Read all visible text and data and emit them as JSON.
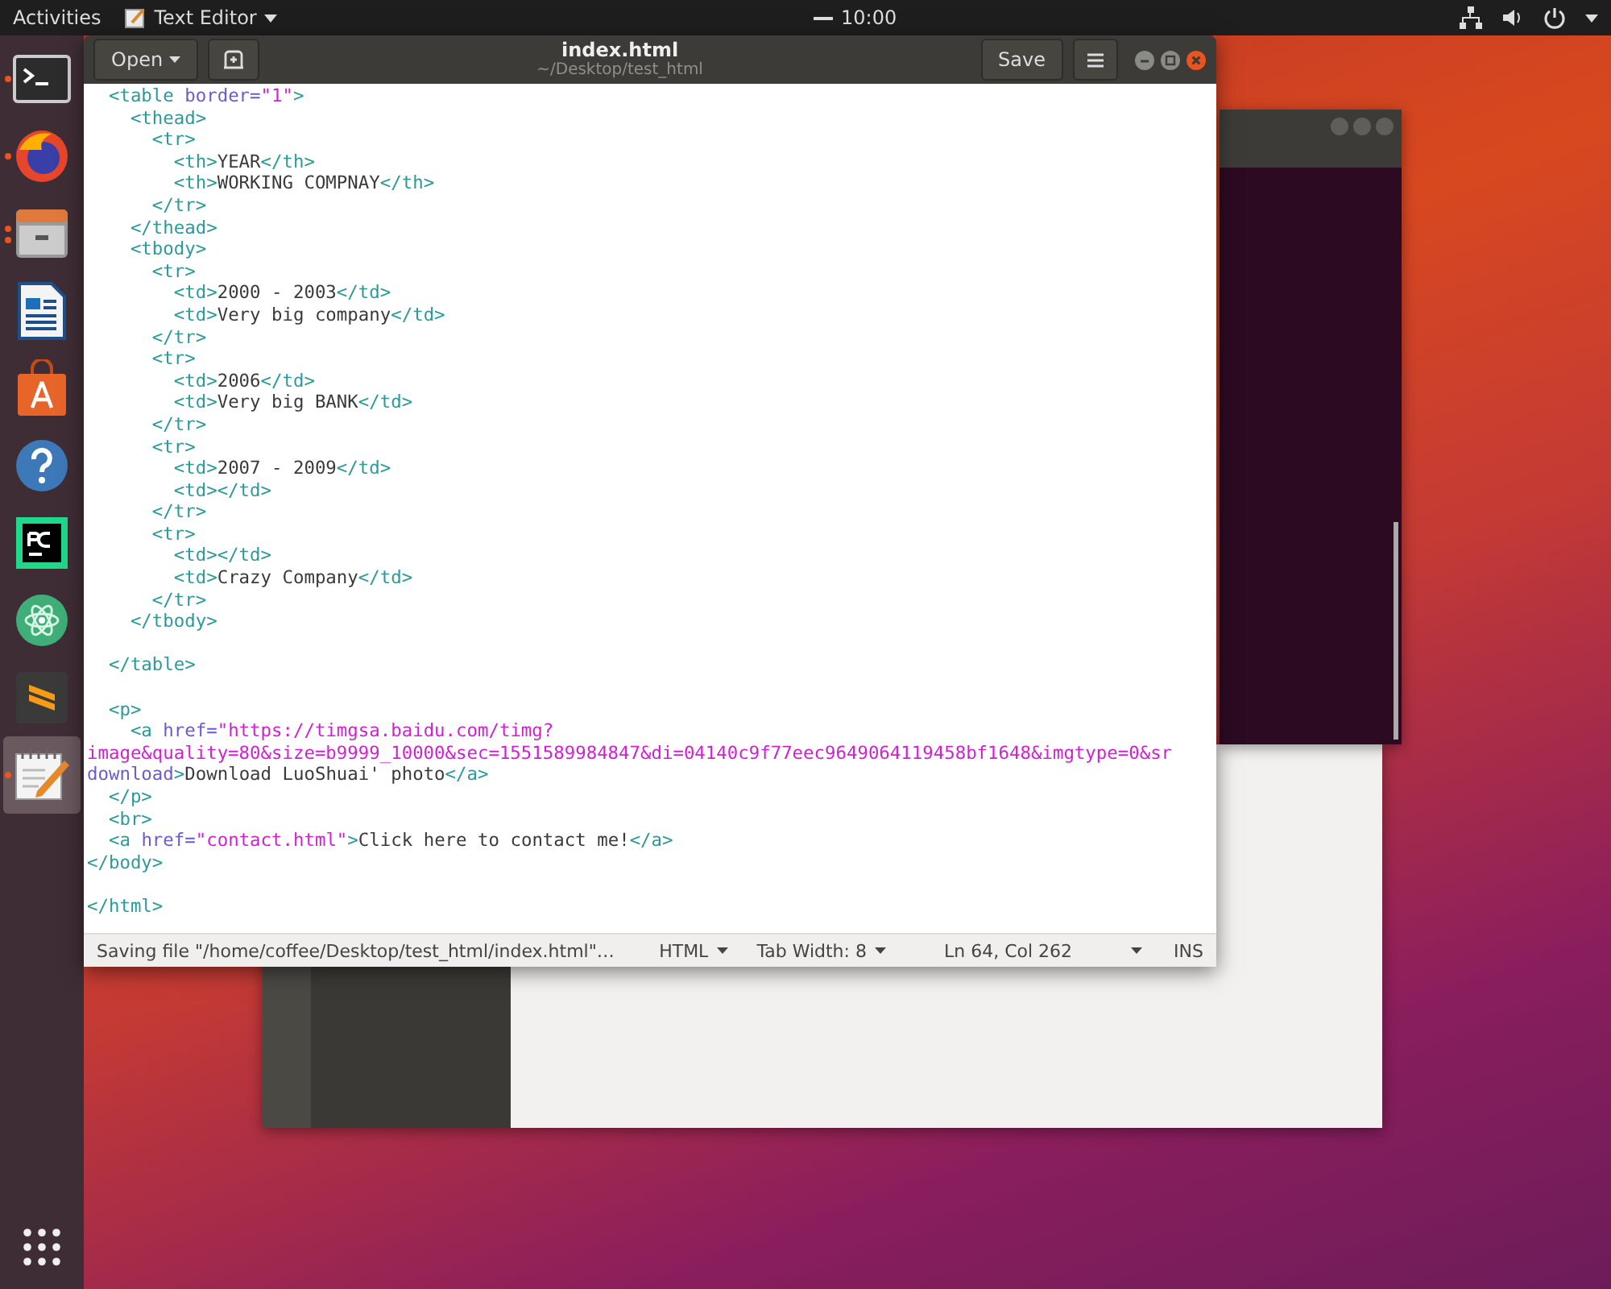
{
  "top_bar": {
    "activities": "Activities",
    "app_menu": "Text Editor",
    "clock": "10:00"
  },
  "dock": [
    {
      "kind": "terminal",
      "running": true,
      "multiple_windows": false,
      "selected": false
    },
    {
      "kind": "browser",
      "running": true,
      "multiple_windows": false,
      "selected": false
    },
    {
      "kind": "files",
      "running": true,
      "multiple_windows": true,
      "selected": false
    },
    {
      "kind": "writer",
      "running": false,
      "multiple_windows": false,
      "selected": false
    },
    {
      "kind": "software",
      "running": false,
      "multiple_windows": false,
      "selected": false
    },
    {
      "kind": "help",
      "running": false,
      "multiple_windows": false,
      "selected": false
    },
    {
      "kind": "pycharm",
      "running": false,
      "multiple_windows": false,
      "selected": false
    },
    {
      "kind": "atom",
      "running": false,
      "multiple_windows": false,
      "selected": false
    },
    {
      "kind": "sublime",
      "running": false,
      "multiple_windows": false,
      "selected": false
    },
    {
      "kind": "editor",
      "running": true,
      "multiple_windows": false,
      "selected": true
    }
  ],
  "editor_window": {
    "open_button": "Open",
    "title": "index.html",
    "subtitle": "~/Desktop/test_html",
    "save_button": "Save",
    "lines": [
      {
        "kind": "code",
        "segments": [
          {
            "kind": "tag",
            "text": "  <table"
          },
          {
            "kind": "attr",
            "text": " border="
          },
          {
            "kind": "string",
            "text": "\"1\""
          },
          {
            "kind": "tag",
            "text": ">"
          }
        ]
      },
      {
        "kind": "code",
        "segments": [
          {
            "kind": "tag",
            "text": "    <thead>"
          }
        ]
      },
      {
        "kind": "code",
        "segments": [
          {
            "kind": "tag",
            "text": "      <tr>"
          }
        ]
      },
      {
        "kind": "code",
        "segments": [
          {
            "kind": "tag",
            "text": "        <th>"
          },
          {
            "kind": "text",
            "text": "YEAR"
          },
          {
            "kind": "tag",
            "text": "</th>"
          }
        ]
      },
      {
        "kind": "code",
        "segments": [
          {
            "kind": "tag",
            "text": "        <th>"
          },
          {
            "kind": "text",
            "text": "WORKING COMPNAY"
          },
          {
            "kind": "tag",
            "text": "</th>"
          }
        ]
      },
      {
        "kind": "code",
        "segments": [
          {
            "kind": "tag",
            "text": "      </tr>"
          }
        ]
      },
      {
        "kind": "code",
        "segments": [
          {
            "kind": "tag",
            "text": "    </thead>"
          }
        ]
      },
      {
        "kind": "code",
        "segments": [
          {
            "kind": "tag",
            "text": "    <tbody>"
          }
        ]
      },
      {
        "kind": "code",
        "segments": [
          {
            "kind": "tag",
            "text": "      <tr>"
          }
        ]
      },
      {
        "kind": "code",
        "segments": [
          {
            "kind": "tag",
            "text": "        <td>"
          },
          {
            "kind": "text",
            "text": "2000 - 2003"
          },
          {
            "kind": "tag",
            "text": "</td>"
          }
        ]
      },
      {
        "kind": "code",
        "segments": [
          {
            "kind": "tag",
            "text": "        <td>"
          },
          {
            "kind": "text",
            "text": "Very big company"
          },
          {
            "kind": "tag",
            "text": "</td>"
          }
        ]
      },
      {
        "kind": "code",
        "segments": [
          {
            "kind": "tag",
            "text": "      </tr>"
          }
        ]
      },
      {
        "kind": "code",
        "segments": [
          {
            "kind": "tag",
            "text": "      <tr>"
          }
        ]
      },
      {
        "kind": "code",
        "segments": [
          {
            "kind": "tag",
            "text": "        <td>"
          },
          {
            "kind": "text",
            "text": "2006"
          },
          {
            "kind": "tag",
            "text": "</td>"
          }
        ]
      },
      {
        "kind": "code",
        "segments": [
          {
            "kind": "tag",
            "text": "        <td>"
          },
          {
            "kind": "text",
            "text": "Very big BANK"
          },
          {
            "kind": "tag",
            "text": "</td>"
          }
        ]
      },
      {
        "kind": "code",
        "segments": [
          {
            "kind": "tag",
            "text": "      </tr>"
          }
        ]
      },
      {
        "kind": "code",
        "segments": [
          {
            "kind": "tag",
            "text": "      <tr>"
          }
        ]
      },
      {
        "kind": "code",
        "segments": [
          {
            "kind": "tag",
            "text": "        <td>"
          },
          {
            "kind": "text",
            "text": "2007 - 2009"
          },
          {
            "kind": "tag",
            "text": "</td>"
          }
        ]
      },
      {
        "kind": "code",
        "segments": [
          {
            "kind": "tag",
            "text": "        <td></td>"
          }
        ]
      },
      {
        "kind": "code",
        "segments": [
          {
            "kind": "tag",
            "text": "      </tr>"
          }
        ]
      },
      {
        "kind": "code",
        "segments": [
          {
            "kind": "tag",
            "text": "      <tr>"
          }
        ]
      },
      {
        "kind": "code",
        "segments": [
          {
            "kind": "tag",
            "text": "        <td></td>"
          }
        ]
      },
      {
        "kind": "code",
        "segments": [
          {
            "kind": "tag",
            "text": "        <td>"
          },
          {
            "kind": "text",
            "text": "Crazy Company"
          },
          {
            "kind": "tag",
            "text": "</td>"
          }
        ]
      },
      {
        "kind": "code",
        "segments": [
          {
            "kind": "tag",
            "text": "      </tr>"
          }
        ]
      },
      {
        "kind": "code",
        "segments": [
          {
            "kind": "tag",
            "text": "    </tbody>"
          }
        ]
      },
      {
        "kind": "blank"
      },
      {
        "kind": "code",
        "segments": [
          {
            "kind": "tag",
            "text": "  </table>"
          }
        ]
      },
      {
        "kind": "blank"
      },
      {
        "kind": "code",
        "segments": [
          {
            "kind": "tag",
            "text": "  <p>"
          }
        ]
      },
      {
        "kind": "code",
        "segments": [
          {
            "kind": "tag",
            "text": "    <a"
          },
          {
            "kind": "attr",
            "text": " href="
          },
          {
            "kind": "string",
            "text": "\"https://timgsa.baidu.com/timg?"
          }
        ]
      },
      {
        "kind": "code",
        "segments": [
          {
            "kind": "string",
            "text": "image&quality=80&size=b9999_10000&sec=1551589984847&di=04140c9f77eec9649064119458bf1648&imgtype=0&sr"
          }
        ]
      },
      {
        "kind": "code",
        "segments": [
          {
            "kind": "attr",
            "text": "download"
          },
          {
            "kind": "tag",
            "text": ">"
          },
          {
            "kind": "text",
            "text": "Download LuoShuai' photo"
          },
          {
            "kind": "tag",
            "text": "</a>"
          }
        ]
      },
      {
        "kind": "code",
        "segments": [
          {
            "kind": "tag",
            "text": "  </p>"
          }
        ]
      },
      {
        "kind": "code",
        "segments": [
          {
            "kind": "tag",
            "text": "  <br>"
          }
        ]
      },
      {
        "kind": "code",
        "segments": [
          {
            "kind": "tag",
            "text": "  <a"
          },
          {
            "kind": "attr",
            "text": " href="
          },
          {
            "kind": "string",
            "text": "\"contact.html\""
          },
          {
            "kind": "tag",
            "text": ">"
          },
          {
            "kind": "text",
            "text": "Click here to contact me!"
          },
          {
            "kind": "tag",
            "text": "</a>"
          }
        ]
      },
      {
        "kind": "code",
        "segments": [
          {
            "kind": "tag",
            "text": "</body>"
          }
        ]
      },
      {
        "kind": "blank"
      },
      {
        "kind": "code",
        "segments": [
          {
            "kind": "tag",
            "text": "</html>"
          }
        ]
      }
    ],
    "status_bar": {
      "message": "Saving file \"/home/coffee/Desktop/test_html/index.html\"…",
      "language": "HTML",
      "tab_width": "Tab Width: 8",
      "position": "Ln 64, Col 262",
      "mode": "INS"
    }
  }
}
